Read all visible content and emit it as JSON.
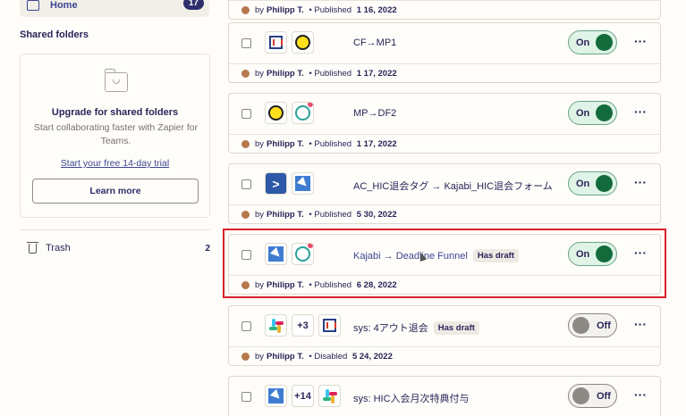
{
  "sidebar": {
    "home": {
      "label": "Home",
      "count": "17"
    },
    "shared_folders_title": "Shared folders",
    "upgrade": {
      "title": "Upgrade for shared folders",
      "description": "Start collaborating faster with Zapier for Teams.",
      "trial_link": "Start your free 14-day trial",
      "learn_button": "Learn more"
    },
    "trash": {
      "label": "Trash",
      "count": "2"
    }
  },
  "zaps": [
    {
      "meta": {
        "by": "by",
        "author": "Philipp T.",
        "status": "Published",
        "date": "1 16, 2022"
      }
    },
    {
      "name": "CF→MP1",
      "has_draft": false,
      "toggle": "On",
      "more": "···",
      "meta": {
        "by": "by",
        "author": "Philipp T.",
        "status": "Published",
        "date": "1 17, 2022"
      }
    },
    {
      "name": "MP→DF2",
      "has_draft": false,
      "toggle": "On",
      "more": "···",
      "meta": {
        "by": "by",
        "author": "Philipp T.",
        "status": "Published",
        "date": "1 17, 2022"
      }
    },
    {
      "name": "AC_HIC退会タグ → Kajabi_HIC退会フォーム",
      "has_draft": false,
      "toggle": "On",
      "more": "···",
      "meta": {
        "by": "by",
        "author": "Philipp T.",
        "status": "Published",
        "date": "5 30, 2022"
      }
    },
    {
      "name": "Kajabi → Deadline Funnel",
      "draft_label": "Has draft",
      "toggle": "On",
      "more": "···",
      "meta": {
        "by": "by",
        "author": "Philipp T.",
        "status": "Published",
        "date": "6 28, 2022"
      }
    },
    {
      "name": "sys: 4アウト退会",
      "draft_label": "Has draft",
      "extra_apps": "+3",
      "toggle": "Off",
      "more": "···",
      "meta": {
        "by": "by",
        "author": "Philipp T.",
        "status": "Disabled",
        "date": "5 24, 2022"
      }
    },
    {
      "name": "sys: HIC入会月次特典付与",
      "extra_apps": "+14",
      "toggle": "Off",
      "more": "···"
    }
  ],
  "icons": {
    "clickfunnels": "clickfunnels-icon",
    "mailchimp": "mailchimp-icon",
    "deadline_funnel": "deadline-funnel-icon",
    "activecampaign": "activecampaign-icon",
    "kajabi": "kajabi-icon",
    "slack": "slack-icon"
  },
  "colors": {
    "accent": "#3d4592",
    "toggle_on": "#136b3c",
    "highlight": "#d8212a"
  }
}
